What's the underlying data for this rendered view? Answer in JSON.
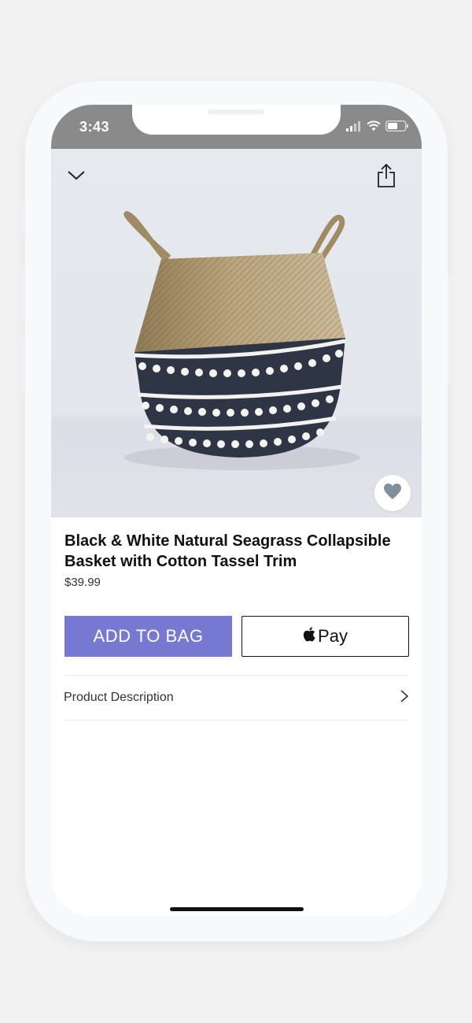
{
  "status_bar": {
    "time": "3:43",
    "background_color": "#8a8a8a"
  },
  "nav": {
    "back_icon": "chevron-down-icon",
    "share_icon": "share-icon"
  },
  "product": {
    "image_description_icon": "basket-photo",
    "favorite_icon": "heart-icon",
    "title": "Black & White Natural Seagrass Collapsible Basket with Cotton Tassel Trim",
    "price": "$39.99"
  },
  "actions": {
    "add_to_bag_label": "ADD TO BAG",
    "apple_pay_label": "Pay",
    "accent_color": "#7678d1"
  },
  "description_row": {
    "label": "Product Description",
    "chevron_icon": "chevron-right-icon"
  }
}
